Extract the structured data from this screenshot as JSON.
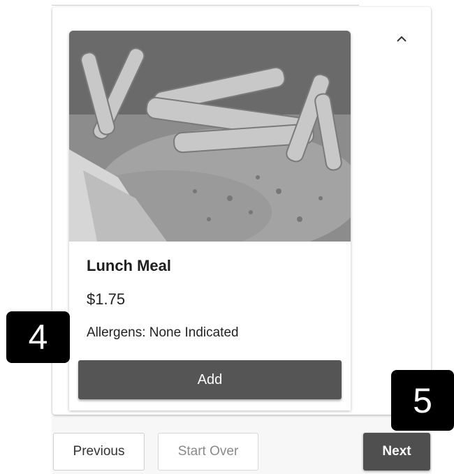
{
  "card": {
    "image_alt": "Lunch Meal photo",
    "name": "Lunch Meal",
    "price": "$1.75",
    "allergens": "Allergens: None Indicated",
    "add_label": "Add"
  },
  "annotations": {
    "badge_4": "4",
    "badge_5": "5"
  },
  "nav": {
    "previous_label": "Previous",
    "start_over_label": "Start Over",
    "next_label": "Next"
  },
  "icons": {
    "collapse": "chevron-up-icon"
  }
}
